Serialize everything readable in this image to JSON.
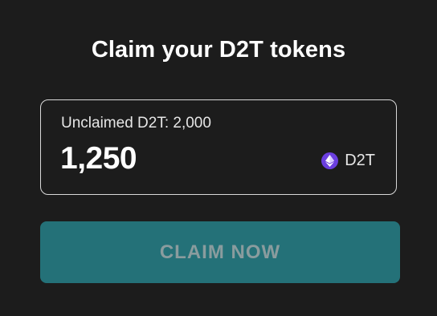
{
  "header": {
    "title": "Claim your D2T tokens"
  },
  "claim_card": {
    "unclaimed_label": "Unclaimed D2T: 2,000",
    "amount_value": "1,250",
    "token_symbol": "D2T",
    "token_icon": "ethereum-icon"
  },
  "actions": {
    "claim_label": "CLAIM NOW"
  },
  "colors": {
    "background": "#1c1c1c",
    "button": "#247178",
    "token_icon": "#6b3fe0"
  }
}
